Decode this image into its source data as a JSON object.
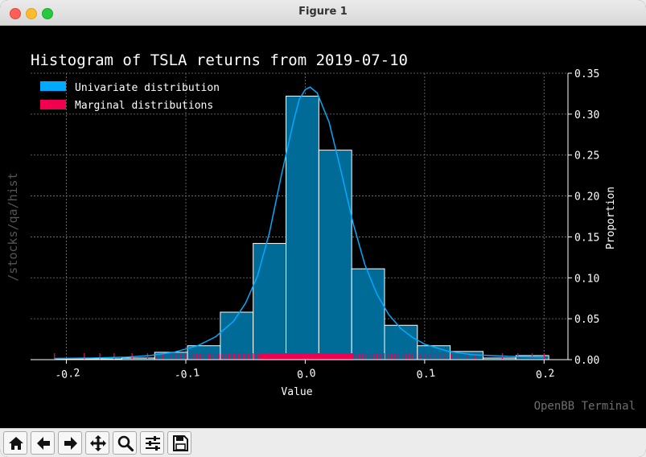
{
  "window": {
    "title": "Figure 1"
  },
  "watermark": "OpenBB Terminal",
  "command_label": "/stocks/qa/hist",
  "chart_data": {
    "type": "bar",
    "title": "Histogram of TSLA returns from 2019-07-10",
    "xlabel": "Value",
    "ylabel": "Proportion",
    "xlim": [
      -0.23,
      0.22
    ],
    "ylim": [
      0,
      0.35
    ],
    "x_ticks": [
      -0.2,
      -0.1,
      0.0,
      0.1,
      0.2
    ],
    "x_tick_labels": [
      "-0.2",
      "-0.1",
      "0.0",
      "0.1",
      "0.2"
    ],
    "y_ticks": [
      0.0,
      0.05,
      0.1,
      0.15,
      0.2,
      0.25,
      0.3,
      0.35
    ],
    "y_tick_labels": [
      "0.00",
      "0.05",
      "0.10",
      "0.15",
      "0.20",
      "0.25",
      "0.30",
      "0.35"
    ],
    "grid": true,
    "legend_position": "top-left",
    "colors": {
      "bars": "#006b96",
      "bar_edge": "#ffffff",
      "kde": "#00aaff",
      "rug": "#f0004f",
      "grid": "#7a7a7a"
    },
    "bins": [
      {
        "left": -0.2086,
        "right": -0.1811,
        "value": 0.001
      },
      {
        "left": -0.1811,
        "right": -0.1536,
        "value": 0.001
      },
      {
        "left": -0.1536,
        "right": -0.1261,
        "value": 0.002
      },
      {
        "left": -0.1261,
        "right": -0.0986,
        "value": 0.009
      },
      {
        "left": -0.0986,
        "right": -0.0711,
        "value": 0.017
      },
      {
        "left": -0.0711,
        "right": -0.0436,
        "value": 0.058
      },
      {
        "left": -0.0436,
        "right": -0.0161,
        "value": 0.142
      },
      {
        "left": -0.0161,
        "right": 0.0114,
        "value": 0.322
      },
      {
        "left": 0.0114,
        "right": 0.0389,
        "value": 0.256
      },
      {
        "left": 0.0389,
        "right": 0.0664,
        "value": 0.111
      },
      {
        "left": 0.0664,
        "right": 0.0939,
        "value": 0.042
      },
      {
        "left": 0.0939,
        "right": 0.1214,
        "value": 0.017
      },
      {
        "left": 0.1214,
        "right": 0.1489,
        "value": 0.01
      },
      {
        "left": 0.1489,
        "right": 0.1764,
        "value": 0.002
      },
      {
        "left": 0.1764,
        "right": 0.2039,
        "value": 0.005
      }
    ],
    "kde": {
      "x": [
        -0.21,
        -0.18,
        -0.15,
        -0.13,
        -0.11,
        -0.09,
        -0.075,
        -0.06,
        -0.05,
        -0.04,
        -0.03,
        -0.02,
        -0.01,
        -0.005,
        0.0,
        0.004,
        0.01,
        0.02,
        0.03,
        0.04,
        0.05,
        0.06,
        0.07,
        0.08,
        0.09,
        0.1,
        0.12,
        0.14,
        0.17,
        0.2
      ],
      "y": [
        0.0015,
        0.002,
        0.003,
        0.005,
        0.009,
        0.017,
        0.028,
        0.047,
        0.069,
        0.102,
        0.155,
        0.225,
        0.29,
        0.318,
        0.33,
        0.333,
        0.326,
        0.29,
        0.23,
        0.167,
        0.116,
        0.08,
        0.055,
        0.038,
        0.027,
        0.019,
        0.01,
        0.006,
        0.004,
        0.003
      ]
    },
    "rug": [
      -0.21,
      -0.185,
      -0.172,
      -0.16,
      -0.145,
      -0.132,
      -0.125,
      -0.119,
      -0.113,
      -0.108,
      -0.104,
      -0.1,
      -0.097,
      -0.094,
      -0.091,
      -0.088,
      -0.085,
      -0.082,
      -0.08,
      -0.077,
      -0.074,
      -0.072,
      -0.069,
      -0.067,
      -0.064,
      -0.062,
      -0.06,
      -0.058,
      -0.056,
      -0.054,
      -0.052,
      -0.05,
      -0.048,
      -0.046,
      -0.044,
      -0.042,
      -0.04,
      -0.038,
      0.04,
      0.042,
      0.045,
      0.048,
      0.051,
      0.054,
      0.057,
      0.06,
      0.063,
      0.066,
      0.069,
      0.072,
      0.075,
      0.078,
      0.081,
      0.084,
      0.087,
      0.09,
      0.093,
      0.096,
      0.1,
      0.104,
      0.108,
      0.112,
      0.117,
      0.122,
      0.128,
      0.135,
      0.142,
      0.165,
      0.178,
      0.19,
      0.2
    ],
    "rug_dense": [
      -0.038,
      0.04
    ],
    "legend": [
      {
        "label": "Univariate distribution",
        "color": "#00aaff"
      },
      {
        "label": "Marginal distributions",
        "color": "#f0004f"
      }
    ]
  },
  "toolbar": {
    "buttons": [
      {
        "name": "home-button",
        "icon": "home-icon"
      },
      {
        "name": "back-button",
        "icon": "arrow-left-icon"
      },
      {
        "name": "forward-button",
        "icon": "arrow-right-icon"
      },
      {
        "name": "pan-button",
        "icon": "move-icon"
      },
      {
        "name": "zoom-button",
        "icon": "magnifier-icon"
      },
      {
        "name": "configure-subplots-button",
        "icon": "sliders-icon"
      },
      {
        "name": "save-button",
        "icon": "floppy-disk-icon"
      }
    ]
  }
}
